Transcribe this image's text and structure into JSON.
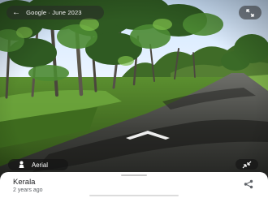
{
  "top_bar": {
    "attribution": "Google · June 2023",
    "back_icon": "arrow-left-icon",
    "expand_icon": "expand-arrows-icon"
  },
  "controls": {
    "aerial_label": "Aerial",
    "aerial_icon": "person-pin-icon",
    "compress_icon": "compress-arrows-icon",
    "navigation_arrow_icon": "navigation-chevron-icon"
  },
  "sheet": {
    "place_name": "Kerala",
    "capture_age": "2 years ago",
    "share_icon": "share-icon"
  },
  "colors": {
    "sheet_bg": "#ffffff",
    "pill_bg": "#282828",
    "road": "#3d3d3d",
    "grass": "#4b8a2c"
  }
}
